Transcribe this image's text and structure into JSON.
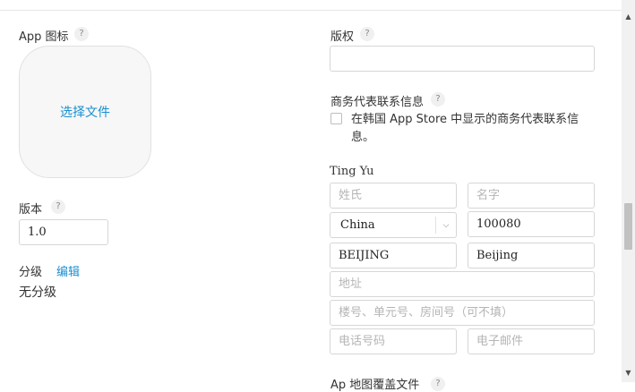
{
  "left": {
    "app_icon_label": "App 图标",
    "choose_file": "选择文件",
    "version_label": "版本",
    "version_value": "1.0",
    "rating_label": "分级",
    "rating_edit": "编辑",
    "rating_value": "无分级"
  },
  "right": {
    "copyright_label": "版权",
    "copyright_value": "",
    "contact_label": "商务代表联系信息",
    "contact_checkbox_text": "在韩国 App Store 中显示的商务代表联系信息。",
    "contact_name": "Ting Yu",
    "last_name_placeholder": "姓氏",
    "first_name_placeholder": "名字",
    "country_value": "China",
    "postal_code_value": "100080",
    "state_value": "BEIJING",
    "city_value": "Beijing",
    "address_placeholder": "地址",
    "address2_placeholder": "楼号、单元号、房间号（可不填）",
    "phone_placeholder": "电话号码",
    "email_placeholder": "电子邮件",
    "next_section_partial": "Ap 地图覆盖文件"
  },
  "help_glyph": "?",
  "scroll": {
    "up_glyph": "▲",
    "down_glyph": "▼"
  }
}
